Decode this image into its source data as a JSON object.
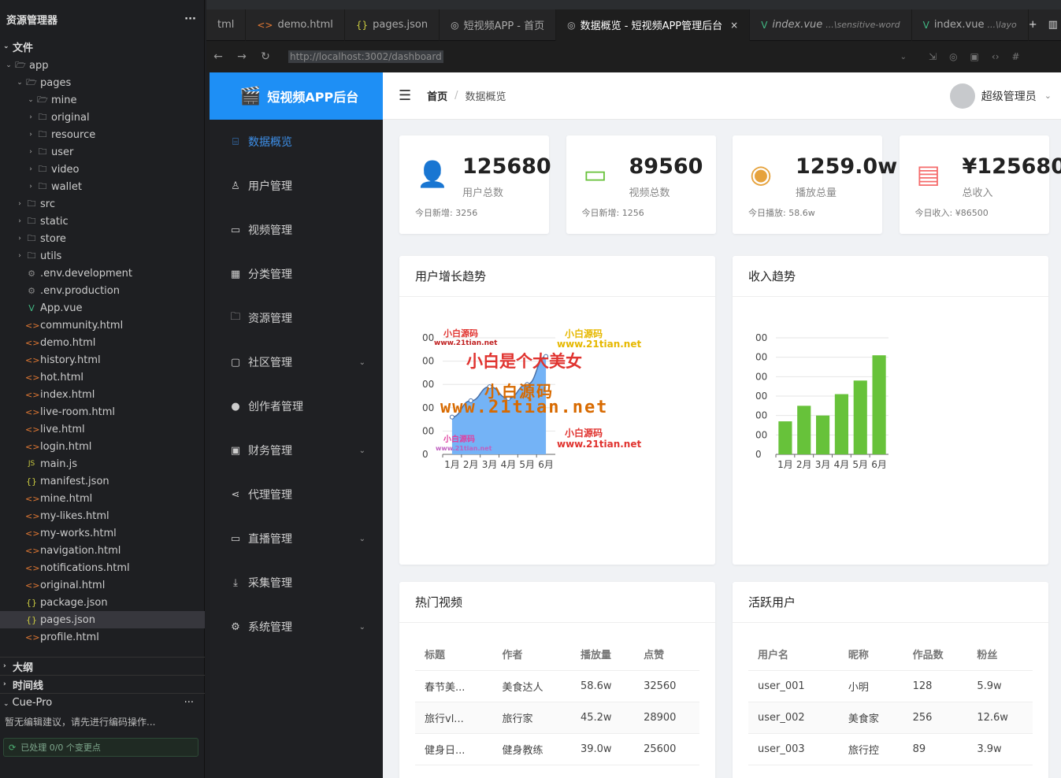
{
  "explorer": {
    "title": "资源管理器",
    "more": "···",
    "section_files": "文件",
    "tree": [
      {
        "label": "app",
        "type": "folder",
        "depth": 0,
        "open": true
      },
      {
        "label": "pages",
        "type": "folder",
        "depth": 1,
        "open": true
      },
      {
        "label": "mine",
        "type": "folder",
        "depth": 2,
        "open": true
      },
      {
        "label": "original",
        "type": "folder",
        "depth": 2,
        "open": false
      },
      {
        "label": "resource",
        "type": "folder",
        "depth": 2,
        "open": false
      },
      {
        "label": "user",
        "type": "folder",
        "depth": 2,
        "open": false
      },
      {
        "label": "video",
        "type": "folder",
        "depth": 2,
        "open": false
      },
      {
        "label": "wallet",
        "type": "folder",
        "depth": 2,
        "open": false
      },
      {
        "label": "src",
        "type": "folder",
        "depth": 1,
        "open": false
      },
      {
        "label": "static",
        "type": "folder",
        "depth": 1,
        "open": false
      },
      {
        "label": "store",
        "type": "folder",
        "depth": 1,
        "open": false
      },
      {
        "label": "utils",
        "type": "folder",
        "depth": 1,
        "open": false
      },
      {
        "label": ".env.development",
        "type": "env",
        "depth": 1
      },
      {
        "label": ".env.production",
        "type": "env",
        "depth": 1
      },
      {
        "label": "App.vue",
        "type": "vue",
        "depth": 1
      },
      {
        "label": "community.html",
        "type": "html",
        "depth": 1
      },
      {
        "label": "demo.html",
        "type": "html",
        "depth": 1
      },
      {
        "label": "history.html",
        "type": "html",
        "depth": 1
      },
      {
        "label": "hot.html",
        "type": "html",
        "depth": 1
      },
      {
        "label": "index.html",
        "type": "html",
        "depth": 1
      },
      {
        "label": "live-room.html",
        "type": "html",
        "depth": 1
      },
      {
        "label": "live.html",
        "type": "html",
        "depth": 1
      },
      {
        "label": "login.html",
        "type": "html",
        "depth": 1
      },
      {
        "label": "main.js",
        "type": "js",
        "depth": 1
      },
      {
        "label": "manifest.json",
        "type": "json",
        "depth": 1
      },
      {
        "label": "mine.html",
        "type": "html",
        "depth": 1
      },
      {
        "label": "my-likes.html",
        "type": "html",
        "depth": 1
      },
      {
        "label": "my-works.html",
        "type": "html",
        "depth": 1
      },
      {
        "label": "navigation.html",
        "type": "html",
        "depth": 1
      },
      {
        "label": "notifications.html",
        "type": "html",
        "depth": 1
      },
      {
        "label": "original.html",
        "type": "html",
        "depth": 1
      },
      {
        "label": "package.json",
        "type": "json",
        "depth": 1
      },
      {
        "label": "pages.json",
        "type": "json",
        "depth": 1,
        "selected": true
      },
      {
        "label": "profile.html",
        "type": "html",
        "depth": 1
      }
    ],
    "outline": "大纲",
    "timeline": "时间线",
    "cue_title": "Cue-Pro",
    "cue_tip": "暂无编辑建议，请先进行编码操作...",
    "cue_status": "已处理 0/0 个变更点"
  },
  "tabs": [
    {
      "label": "tml",
      "icon": ""
    },
    {
      "label": "demo.html",
      "icon": "<>"
    },
    {
      "label": "pages.json",
      "icon": "{}"
    },
    {
      "label": "短视频APP - 首页",
      "icon": "◎"
    },
    {
      "label": "数据概览 - 短视频APP管理后台",
      "icon": "◎",
      "active": true
    },
    {
      "label": "index.vue",
      "icon": "V",
      "extra": "...\\sensitive-word"
    },
    {
      "label": "index.vue",
      "icon": "V",
      "extra": "...\\layo"
    }
  ],
  "tab_actions": [
    "+",
    "▥",
    "···"
  ],
  "address": {
    "url": "http://localhost:3002/dashboard"
  },
  "app": {
    "brand": "短视频APP后台",
    "menu": [
      {
        "label": "数据概览",
        "icon": "dashboard-icon",
        "glyph": "⌸",
        "active": true
      },
      {
        "label": "用户管理",
        "icon": "user-icon",
        "glyph": "♙"
      },
      {
        "label": "视频管理",
        "icon": "video-icon",
        "glyph": "▭"
      },
      {
        "label": "分类管理",
        "icon": "grid-icon",
        "glyph": "▦"
      },
      {
        "label": "资源管理",
        "icon": "folder-icon",
        "glyph": "🗀"
      },
      {
        "label": "社区管理",
        "icon": "chat-icon",
        "glyph": "▢",
        "arrow": true
      },
      {
        "label": "创作者管理",
        "icon": "person-icon",
        "glyph": "●"
      },
      {
        "label": "财务管理",
        "icon": "wallet-icon",
        "glyph": "▣",
        "arrow": true
      },
      {
        "label": "代理管理",
        "icon": "share-icon",
        "glyph": "⋖"
      },
      {
        "label": "直播管理",
        "icon": "live-icon",
        "glyph": "▭",
        "arrow": true
      },
      {
        "label": "采集管理",
        "icon": "download-icon",
        "glyph": "⤓"
      },
      {
        "label": "系统管理",
        "icon": "gear-icon",
        "glyph": "⚙",
        "arrow": true
      }
    ],
    "breadcrumb": {
      "home": "首页",
      "current": "数据概览"
    },
    "user": "超级管理员",
    "stats": [
      {
        "value": "125680",
        "label": "用户总数",
        "sub": "今日新增: 3256",
        "icon": "user-outline-icon",
        "glyph": "👤",
        "color": "#409eff"
      },
      {
        "value": "89560",
        "label": "视频总数",
        "sub": "今日新增: 1256",
        "icon": "video-camera-icon",
        "glyph": "▭",
        "color": "#67c23a"
      },
      {
        "value": "1259.0w",
        "label": "播放总量",
        "sub": "今日播放: 58.6w",
        "icon": "eye-icon",
        "glyph": "◉",
        "color": "#e6a23c"
      },
      {
        "value": "¥125680",
        "label": "总收入",
        "sub": "今日收入: ¥86500",
        "icon": "wallet-outline-icon",
        "glyph": "▤",
        "color": "#f56c6c"
      }
    ],
    "user_chart": {
      "title": "用户增长趋势"
    },
    "income_chart": {
      "title": "收入趋势"
    },
    "watermarks": [
      "小白源码",
      "www.21tian.net",
      "小白源码",
      "www.21tian.net",
      "小白是个大美女",
      "小白源码",
      "www.21tian.net",
      "小白源码",
      "www.21tian.net",
      "小白源码",
      "www.21tian.net"
    ],
    "hot_videos": {
      "title": "热门视频",
      "headers": [
        "标题",
        "作者",
        "播放量",
        "点赞"
      ],
      "rows": [
        [
          "春节美...",
          "美食达人",
          "58.6w",
          "32560"
        ],
        [
          "旅行vl...",
          "旅行家",
          "45.2w",
          "28900"
        ],
        [
          "健身日...",
          "健身教练",
          "39.0w",
          "25600"
        ]
      ]
    },
    "active_users": {
      "title": "活跃用户",
      "headers": [
        "用户名",
        "昵称",
        "作品数",
        "粉丝"
      ],
      "rows": [
        [
          "user_001",
          "小明",
          "128",
          "5.9w"
        ],
        [
          "user_002",
          "美食家",
          "256",
          "12.6w"
        ],
        [
          "user_003",
          "旅行控",
          "89",
          "3.9w"
        ]
      ]
    }
  },
  "chart_data": [
    {
      "type": "area",
      "title": "用户增长趋势",
      "categories": [
        "1月",
        "2月",
        "3月",
        "4月",
        "5月",
        "6月"
      ],
      "y_tick_labels": [
        "0",
        "00",
        "00",
        "00",
        "00",
        "00"
      ],
      "values": [
        1.6,
        2.3,
        2.9,
        2.4,
        3.0,
        4.2
      ],
      "ylim": [
        0,
        5
      ],
      "color": "#74b3f6"
    },
    {
      "type": "bar",
      "title": "收入趋势",
      "categories": [
        "1月",
        "2月",
        "3月",
        "4月",
        "5月",
        "6月"
      ],
      "y_tick_labels": [
        "0",
        "00",
        "00",
        "00",
        "00",
        "00",
        "00"
      ],
      "values": [
        1.7,
        2.5,
        2.0,
        3.1,
        3.8,
        5.1
      ],
      "ylim": [
        0,
        6
      ],
      "color": "#67c23a"
    }
  ]
}
